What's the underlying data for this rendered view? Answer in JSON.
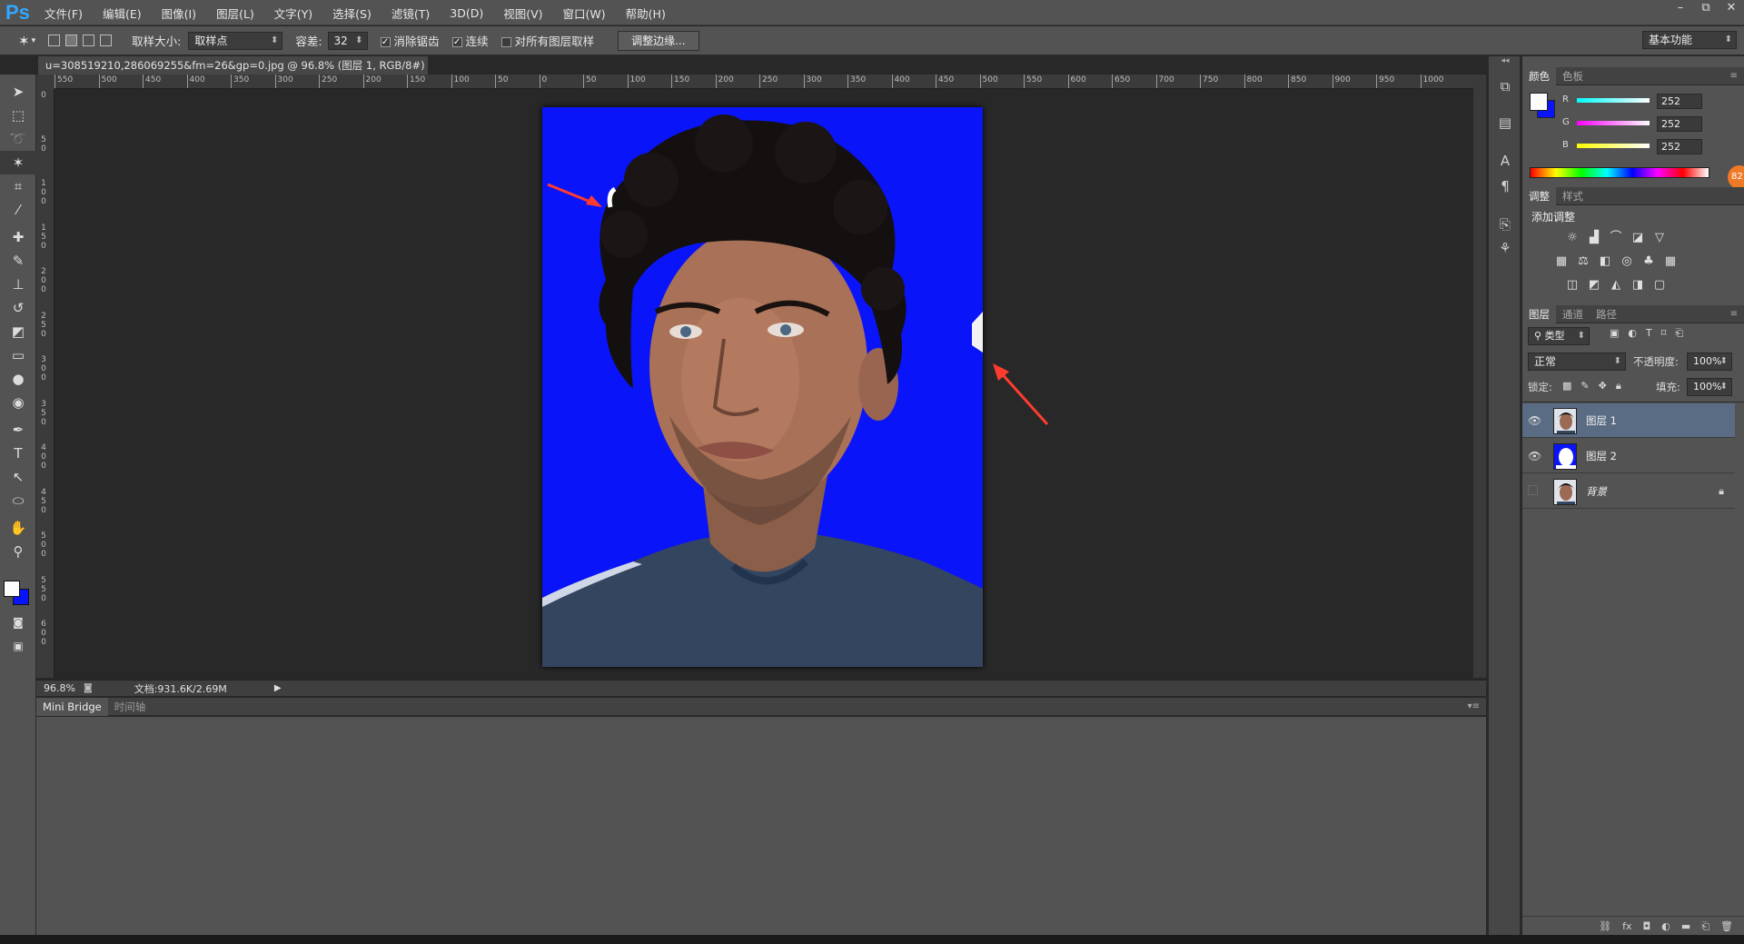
{
  "app": {
    "logo": "Ps",
    "accent": "#31a8ff"
  },
  "menu": [
    "文件(F)",
    "编辑(E)",
    "图像(I)",
    "图层(L)",
    "文字(Y)",
    "选择(S)",
    "滤镜(T)",
    "3D(D)",
    "视图(V)",
    "窗口(W)",
    "帮助(H)"
  ],
  "window_controls": [
    "–",
    "⧉",
    "✕"
  ],
  "options": {
    "sample_size_label": "取样大小:",
    "sample_size_value": "取样点",
    "tolerance_label": "容差:",
    "tolerance_value": "32",
    "antialias_label": "消除锯齿",
    "contiguous_label": "连续",
    "sample_all_label": "对所有图层取样",
    "refine_edge_label": "调整边缘...",
    "workspace_value": "基本功能"
  },
  "document": {
    "tab_title": "u=308519210,286069255&fm=26&gp=0.jpg @ 96.8% (图层 1, RGB/8#) *",
    "tab_close": "×",
    "zoom": "96.8%",
    "doc_info": "文档:931.6K/2.69M",
    "background_color": "#0a14f8"
  },
  "rulers": {
    "h_labels": [
      "550",
      "500",
      "450",
      "400",
      "350",
      "300",
      "250",
      "200",
      "150",
      "100",
      "50",
      "0",
      "50",
      "100",
      "150",
      "200",
      "250",
      "300",
      "350",
      "400",
      "450",
      "500",
      "550",
      "600",
      "650",
      "700",
      "750",
      "800",
      "850",
      "900",
      "950",
      "1000"
    ],
    "v_labels": [
      "0",
      "50",
      "100",
      "150",
      "200",
      "250",
      "300",
      "350",
      "400",
      "450",
      "500",
      "550",
      "600"
    ]
  },
  "bottom_tabs": [
    "Mini Bridge",
    "时间轴"
  ],
  "color_panel": {
    "tabs": [
      "颜色",
      "色板"
    ],
    "channels": [
      {
        "label": "R",
        "value": "252"
      },
      {
        "label": "G",
        "value": "252"
      },
      {
        "label": "B",
        "value": "252"
      }
    ],
    "foreground": "#fcfcfc",
    "background": "#0a14f8"
  },
  "adjust_panel": {
    "tabs": [
      "调整",
      "样式"
    ],
    "title": "添加调整"
  },
  "layers_panel": {
    "tabs": [
      "图层",
      "通道",
      "路径"
    ],
    "filter_kind": "类型",
    "blend_mode": "正常",
    "opacity_label": "不透明度:",
    "opacity_value": "100%",
    "lock_label": "锁定:",
    "fill_label": "填充:",
    "fill_value": "100%",
    "layers": [
      {
        "name": "图层 1",
        "visible": true,
        "selected": true
      },
      {
        "name": "图层 2",
        "visible": true,
        "selected": false
      },
      {
        "name": "背景",
        "visible": false,
        "selected": false
      }
    ]
  },
  "badge": "82"
}
